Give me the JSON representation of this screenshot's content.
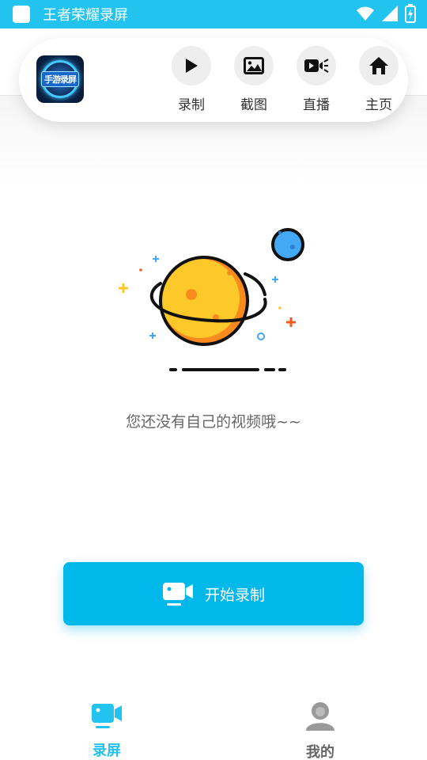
{
  "status_bar": {
    "title": "王者荣耀录屏",
    "bg_color": "#22c3ee"
  },
  "app_logo": {
    "text": "手游录屏",
    "icon": "app-logo-icon"
  },
  "toolbar": {
    "items": [
      {
        "label": "录制",
        "icon": "play-icon"
      },
      {
        "label": "截图",
        "icon": "image-icon"
      },
      {
        "label": "直播",
        "icon": "live-camera-icon"
      },
      {
        "label": "主页",
        "icon": "home-icon"
      }
    ]
  },
  "empty_state": {
    "message": "您还没有自己的视频哦~~",
    "illustration": "planet-illustration"
  },
  "record_button": {
    "label": "开始录制",
    "icon": "video-camera-icon",
    "color": "#01b8ea"
  },
  "bottom_nav": {
    "items": [
      {
        "label": "录屏",
        "icon": "video-camera-icon",
        "active": true,
        "color": "#22c3ee"
      },
      {
        "label": "我的",
        "icon": "user-icon",
        "active": false,
        "color": "#666666"
      }
    ]
  }
}
